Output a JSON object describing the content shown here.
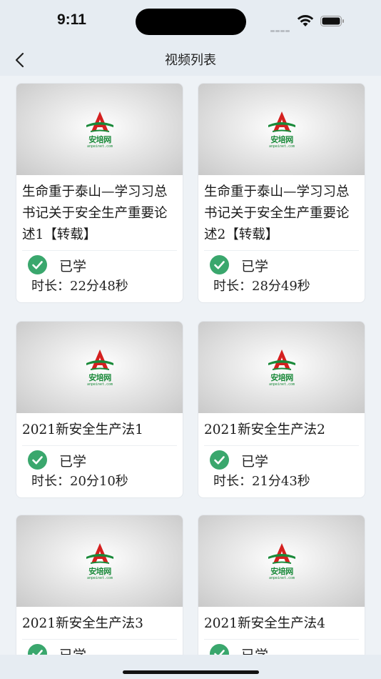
{
  "status_bar": {
    "time": "9:11"
  },
  "nav": {
    "title": "视频列表"
  },
  "logo": {
    "chinese": "安培网",
    "url": "anpeinet.com"
  },
  "videos": [
    {
      "title": "生命重于泰山—学习习总书记关于安全生产重要论述1【转载】",
      "status": "已学",
      "duration": "时长：22分48秒"
    },
    {
      "title": "生命重于泰山—学习习总书记关于安全生产重要论述2【转载】",
      "status": "已学",
      "duration": "时长：28分49秒"
    },
    {
      "title": "2021新安全生产法1",
      "status": "已学",
      "duration": "时长：20分10秒"
    },
    {
      "title": "2021新安全生产法2",
      "status": "已学",
      "duration": "时长：21分43秒"
    },
    {
      "title": "2021新安全生产法3",
      "status": "已学",
      "duration": ""
    },
    {
      "title": "2021新安全生产法4",
      "status": "已学",
      "duration": ""
    }
  ],
  "colors": {
    "accent_green": "#3aa76d",
    "brand_red": "#d4201f",
    "brand_green": "#1a8a3a"
  }
}
